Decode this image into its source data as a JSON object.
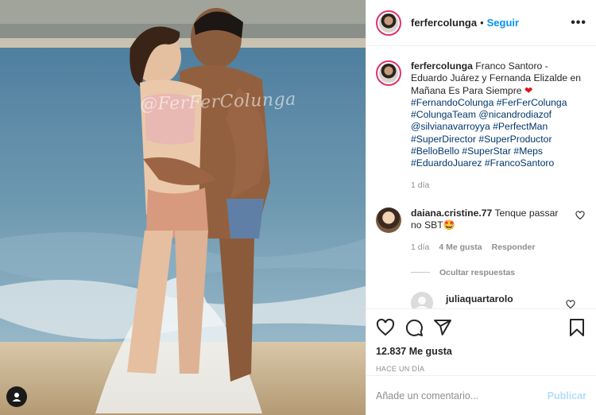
{
  "post": {
    "photo": {
      "watermark": "@FerFerColunga"
    },
    "header": {
      "username": "ferfercolunga",
      "separator": "•",
      "follow_label": "Seguir",
      "more_label": "•••"
    },
    "caption": {
      "username": "ferfercolunga",
      "text": "Franco Santoro - Eduardo Juárez y Fernanda Elizalde en Mañana Es Para Siempre",
      "heart": "❤",
      "tags": [
        "#FernandoColunga",
        "#FerFerColunga",
        "#ColungaTeam",
        "@nicandrodiazof",
        "@silvianavarroyya",
        "#PerfectMan",
        "#SuperDirector",
        "#SuperProductor",
        "#BelloBello",
        "#SuperStar",
        "#Meps",
        "#EduardoJuarez",
        "#FrancoSantoro"
      ],
      "time": "1 día"
    },
    "comments": [
      {
        "username": "daiana.cristine.77",
        "text": "Tenque passar no SBT🤩",
        "time": "1 día",
        "likes": "4 Me gusta",
        "reply_label": "Responder",
        "replies_toggle": "Ocultar respuestas",
        "replies": [
          {
            "username": "juliaquartarolo"
          }
        ]
      }
    ],
    "likes": "12.837 Me gusta",
    "date": "HACE UN DÍA",
    "add_comment": {
      "placeholder": "Añade un comentario...",
      "publish_label": "Publicar"
    },
    "colors": {
      "link": "#0095f6",
      "hashtag": "#00376b",
      "muted": "#8e8e8e",
      "heart": "#e0141e"
    },
    "icons": [
      "heart-icon",
      "comment-icon",
      "share-icon",
      "bookmark-icon",
      "user-tag-icon",
      "more-icon"
    ]
  }
}
